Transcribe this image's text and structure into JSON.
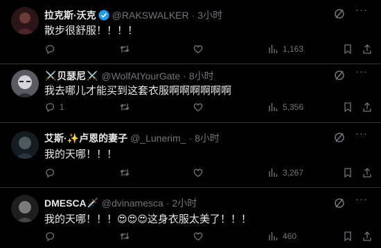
{
  "tweets": [
    {
      "name": "拉克斯·沃克",
      "verified": true,
      "handle": "@RAKSWALKER",
      "sep": "·",
      "time": "3小时",
      "text": "散步很舒服！！！！",
      "replies": "",
      "views": "1,163",
      "avatar_colors": [
        "#3a1f22",
        "#8a4b48"
      ]
    },
    {
      "name_prefix": "⚔️",
      "name": "贝瑟尼",
      "name_suffix": "⚔️",
      "handle": "@WolfAtYourGate",
      "sep": "·",
      "time": "8小时",
      "text": "我去哪儿才能买到这套衣服啊啊啊啊啊啊",
      "replies": "1",
      "views": "5,356",
      "avatar_colors": [
        "#c9c9cf",
        "#404048"
      ]
    },
    {
      "name": "艾斯·✨卢恩的妻子",
      "handle": "@_Lunerim_",
      "sep": "·",
      "time": "8小时",
      "text": "我的天哪！！！",
      "replies": "",
      "views": "3,267",
      "avatar_colors": [
        "#1c2a30",
        "#5a6a70"
      ]
    },
    {
      "name": "DMESCA",
      "name_suffix": "🗡️",
      "handle": "@dvinamesca",
      "sep": "·",
      "time": "2小时",
      "text_before": "我的天哪！！！",
      "text_emoji": "😍😍😍",
      "text_after": "这身衣服太美了！！！",
      "replies": "",
      "views": "460",
      "avatar_colors": [
        "#2a2a2a",
        "#8a8a8a"
      ]
    }
  ]
}
